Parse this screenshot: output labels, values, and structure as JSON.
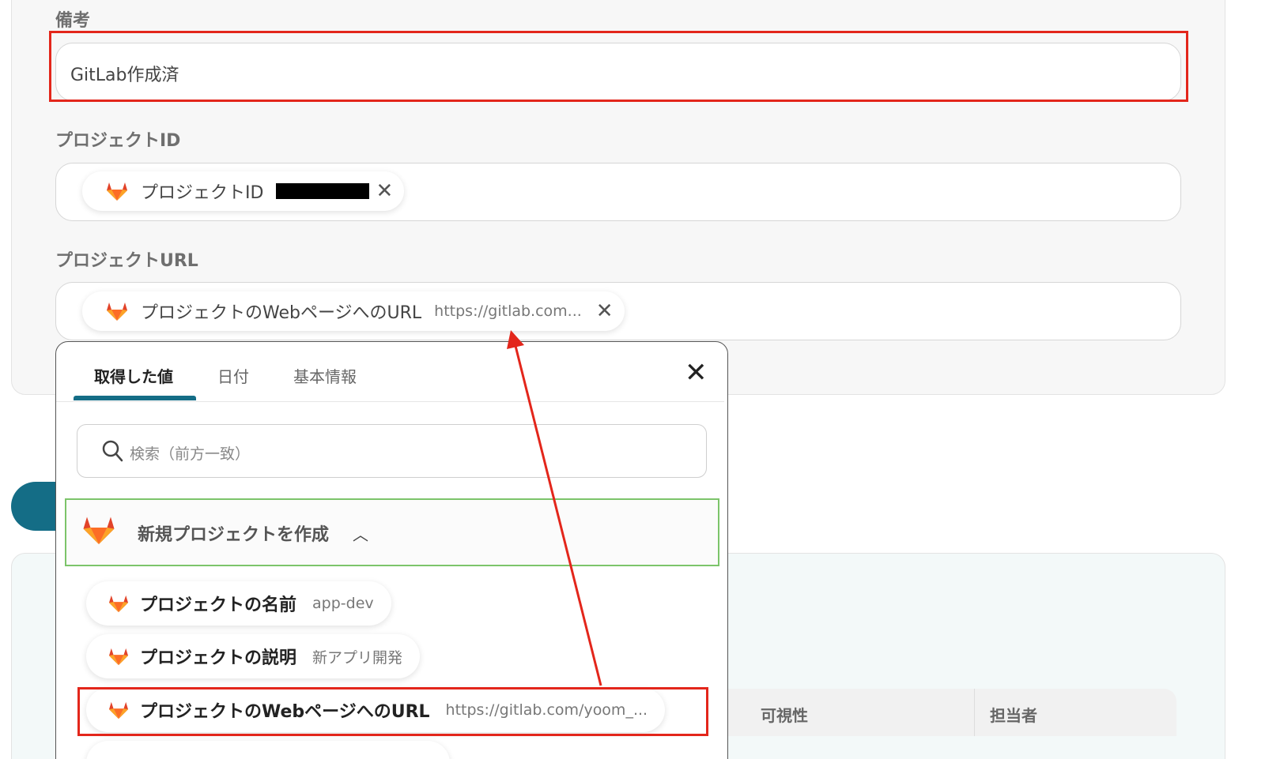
{
  "form": {
    "remarks_label": "備考",
    "remarks_value": "GitLab作成済",
    "project_id_label": "プロジェクトID",
    "project_id_chip_label": "プロジェクトID",
    "project_url_label": "プロジェクトURL",
    "project_url_chip_label": "プロジェクトのWebページへのURL",
    "project_url_chip_value": "https://gitlab.com..."
  },
  "popup": {
    "tabs": [
      {
        "label": "取得した値",
        "active": true
      },
      {
        "label": "日付",
        "active": false
      },
      {
        "label": "基本情報",
        "active": false
      }
    ],
    "search_placeholder": "検索（前方一致）",
    "group_label": "新規プロジェクトを作成",
    "items": [
      {
        "label": "プロジェクトの名前",
        "value": "app-dev"
      },
      {
        "label": "プロジェクトの説明",
        "value": "新アプリ開発"
      },
      {
        "label": "プロジェクトのWebページへのURL",
        "value": "https://gitlab.com/yoom_..."
      }
    ]
  },
  "table": {
    "headers": [
      "可視性",
      "担当者"
    ]
  },
  "icons": {
    "fox": "gitlab-icon",
    "close": "close-icon",
    "search": "search-icon",
    "chevron": "chevron-up-icon"
  },
  "colors": {
    "accent": "#146d86",
    "highlight": "#e3261b",
    "group_border": "#7cc46a",
    "gitlab_orange": "#e24329"
  }
}
